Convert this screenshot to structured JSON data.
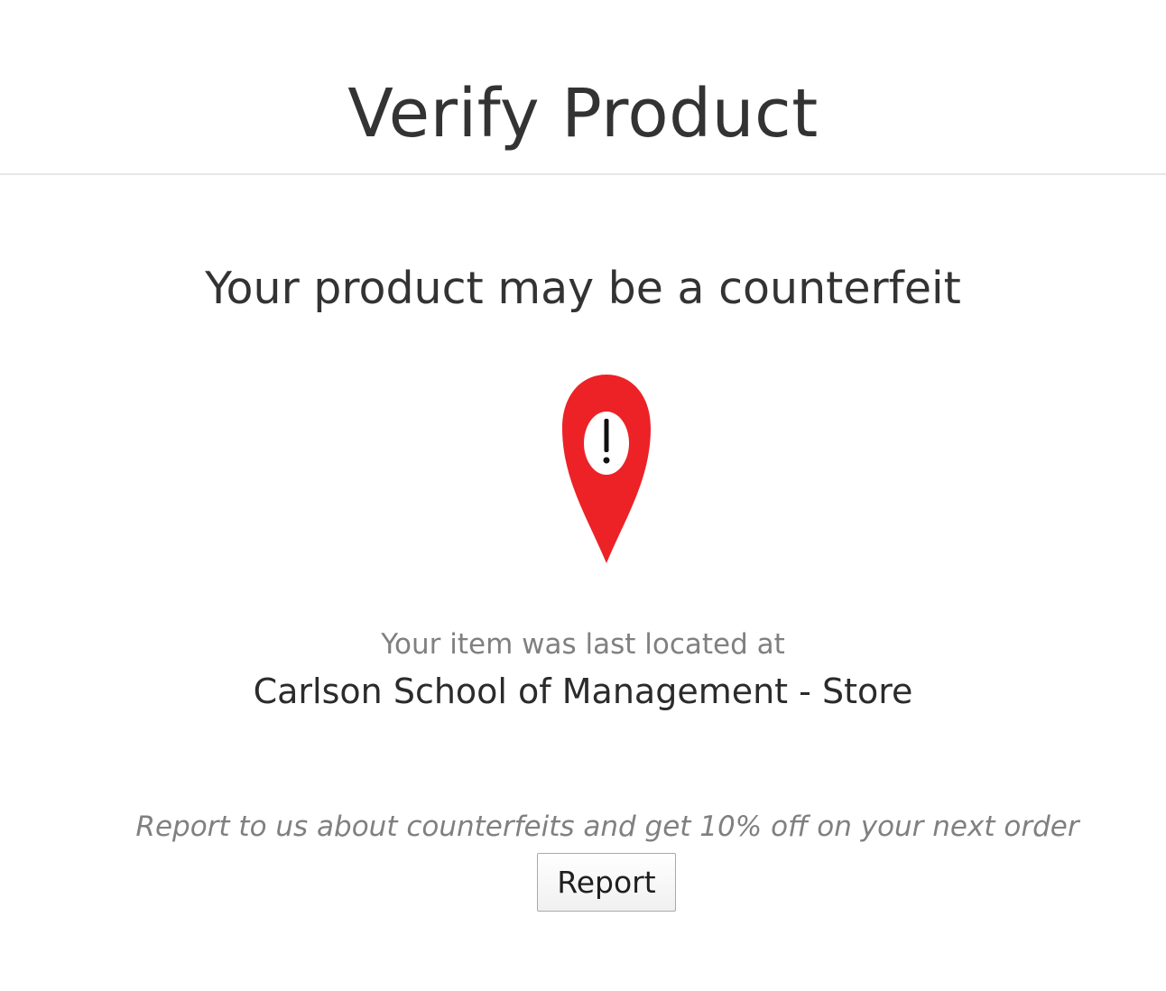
{
  "header": {
    "title": "Verify Product"
  },
  "result": {
    "heading": "Your product may be a counterfeit",
    "icon": "map-pin-alert-icon",
    "icon_color": "#ec2227",
    "location_caption": "Your item was last located at",
    "location_name": "Carlson School of Management - Store"
  },
  "report": {
    "prompt": "Report to us about counterfeits and get 10% off on your next order",
    "button_label": "Report"
  }
}
